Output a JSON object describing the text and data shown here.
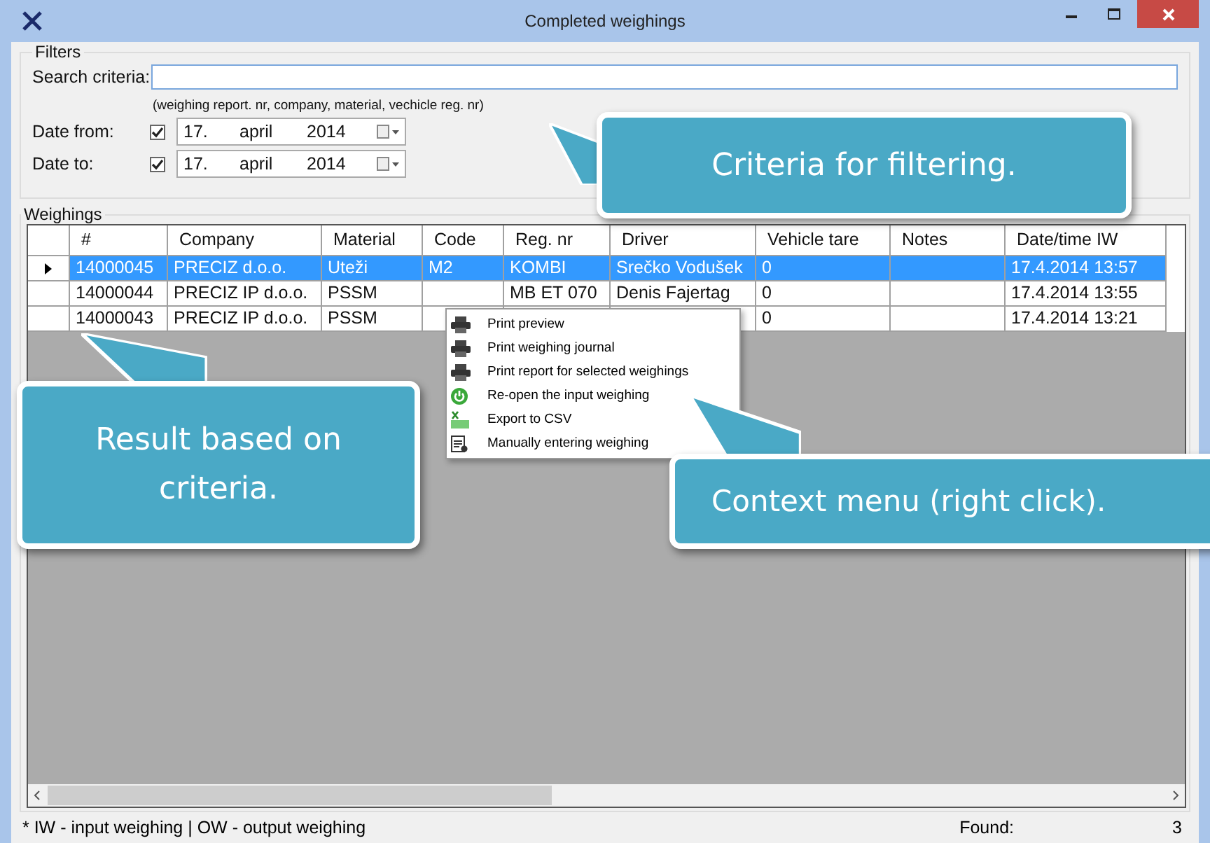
{
  "window": {
    "title": "Completed weighings"
  },
  "filters": {
    "title": "Filters",
    "search_label": "Search criteria:",
    "search_hint": "(weighing report. nr, company, material, vechicle reg. nr)",
    "dates": [
      {
        "label": "Date from:",
        "checked": true,
        "day": "17.",
        "month": "april",
        "year": "2014"
      },
      {
        "label": "Date to:",
        "checked": true,
        "day": "17.",
        "month": "april",
        "year": "2014"
      }
    ]
  },
  "weighings": {
    "title": "Weighings",
    "columns": [
      "#",
      "Company",
      "Material",
      "Code",
      "Reg. nr",
      "Driver",
      "Vehicle tare",
      "Notes",
      "Date/time IW"
    ],
    "rows": [
      {
        "selected": true,
        "cells": [
          "14000045",
          "PRECIZ d.o.o.",
          "Uteži",
          "M2",
          "KOMBI",
          "Srečko Vodušek",
          "0",
          null,
          "17.4.2014 13:57"
        ]
      },
      {
        "selected": false,
        "cells": [
          "14000044",
          "PRECIZ IP d.o.o.",
          "PSSM",
          null,
          "MB ET 070",
          "Denis Fajertag",
          "0",
          null,
          "17.4.2014 13:55"
        ]
      },
      {
        "selected": false,
        "cells": [
          "14000043",
          "PRECIZ IP d.o.o.",
          "PSSM",
          null,
          null,
          null,
          "0",
          null,
          "17.4.2014 13:21"
        ]
      }
    ]
  },
  "context_menu": [
    {
      "kind": "print",
      "label": "Print preview"
    },
    {
      "kind": "print",
      "label": "Print weighing journal"
    },
    {
      "kind": "print",
      "label": "Print report for selected weighings"
    },
    {
      "kind": "reopen",
      "label": "Re-open the input weighing"
    },
    {
      "kind": "csv",
      "label": "Export to CSV"
    },
    {
      "kind": "manual",
      "label": "Manually entering weighing"
    }
  ],
  "status_bar": {
    "note": "* IW - input weighing | OW - output weighing",
    "found_label": "Found:",
    "found_value": "3"
  },
  "callouts": [
    {
      "text": "Criteria for filtering."
    },
    {
      "text": "Result based on criteria."
    },
    {
      "text": "Context menu (right click)."
    }
  ]
}
